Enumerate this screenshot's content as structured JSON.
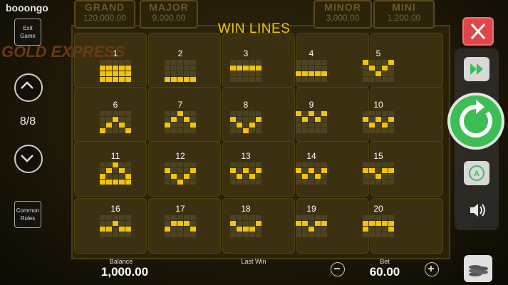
{
  "brand": "booongo",
  "jackpots": [
    {
      "name": "GRAND",
      "value": "120,000.00"
    },
    {
      "name": "MAJOR",
      "value": "9,000.00"
    },
    {
      "name": "MINOR",
      "value": "3,000.00"
    },
    {
      "name": "MINI",
      "value": "1,200.00"
    }
  ],
  "game_logo": "GOLD EXPRESS",
  "overlay": {
    "title": "WIN LINES",
    "lines": [
      {
        "number": "1",
        "pattern": [
          0,
          0,
          0,
          0,
          0,
          1,
          1,
          1,
          1,
          1,
          1,
          1,
          1,
          1,
          1,
          1,
          1,
          1,
          1,
          1
        ]
      },
      {
        "number": "2",
        "pattern": [
          0,
          0,
          0,
          0,
          0,
          0,
          0,
          0,
          0,
          0,
          0,
          0,
          0,
          0,
          0,
          1,
          1,
          1,
          1,
          1
        ]
      },
      {
        "number": "3",
        "pattern": [
          0,
          0,
          0,
          0,
          0,
          1,
          1,
          1,
          1,
          1,
          0,
          0,
          0,
          0,
          0,
          0,
          0,
          0,
          0,
          0
        ]
      },
      {
        "number": "4",
        "pattern": [
          0,
          0,
          0,
          0,
          0,
          0,
          0,
          0,
          0,
          0,
          1,
          1,
          1,
          1,
          1,
          0,
          0,
          0,
          0,
          0
        ]
      },
      {
        "number": "5",
        "pattern": [
          1,
          0,
          0,
          0,
          1,
          0,
          1,
          0,
          1,
          0,
          0,
          0,
          1,
          0,
          0,
          0,
          0,
          0,
          0,
          0
        ]
      },
      {
        "number": "6",
        "pattern": [
          0,
          0,
          0,
          0,
          0,
          0,
          0,
          1,
          0,
          0,
          0,
          1,
          0,
          1,
          0,
          1,
          0,
          0,
          0,
          1
        ]
      },
      {
        "number": "7",
        "pattern": [
          0,
          0,
          1,
          0,
          0,
          0,
          1,
          0,
          1,
          0,
          1,
          0,
          0,
          0,
          1,
          0,
          0,
          0,
          0,
          0
        ]
      },
      {
        "number": "8",
        "pattern": [
          0,
          0,
          0,
          0,
          0,
          1,
          0,
          0,
          0,
          1,
          0,
          1,
          0,
          1,
          0,
          0,
          0,
          1,
          0,
          0
        ]
      },
      {
        "number": "9",
        "pattern": [
          1,
          0,
          1,
          0,
          1,
          0,
          1,
          0,
          1,
          0,
          0,
          0,
          0,
          0,
          0,
          0,
          0,
          0,
          0,
          0
        ]
      },
      {
        "number": "10",
        "pattern": [
          0,
          0,
          0,
          0,
          0,
          1,
          0,
          1,
          0,
          1,
          0,
          1,
          0,
          1,
          0,
          0,
          0,
          0,
          0,
          0
        ]
      },
      {
        "number": "11",
        "pattern": [
          0,
          0,
          1,
          0,
          0,
          0,
          1,
          0,
          1,
          0,
          1,
          0,
          0,
          0,
          1,
          1,
          1,
          1,
          1,
          1
        ]
      },
      {
        "number": "12",
        "pattern": [
          0,
          0,
          0,
          0,
          0,
          1,
          0,
          0,
          0,
          1,
          0,
          1,
          0,
          1,
          0,
          0,
          0,
          1,
          0,
          0
        ]
      },
      {
        "number": "13",
        "pattern": [
          0,
          0,
          0,
          0,
          0,
          1,
          0,
          1,
          0,
          1,
          0,
          1,
          0,
          1,
          0,
          0,
          0,
          0,
          0,
          0
        ]
      },
      {
        "number": "14",
        "pattern": [
          0,
          0,
          0,
          0,
          0,
          1,
          0,
          1,
          0,
          1,
          0,
          1,
          0,
          1,
          0,
          0,
          0,
          0,
          0,
          0
        ]
      },
      {
        "number": "15",
        "pattern": [
          0,
          0,
          0,
          0,
          0,
          1,
          1,
          0,
          1,
          1,
          0,
          0,
          1,
          0,
          0,
          0,
          0,
          0,
          0,
          0
        ]
      },
      {
        "number": "16",
        "pattern": [
          0,
          0,
          0,
          0,
          0,
          0,
          0,
          1,
          0,
          0,
          1,
          1,
          0,
          1,
          1,
          0,
          0,
          0,
          0,
          0
        ]
      },
      {
        "number": "17",
        "pattern": [
          0,
          0,
          0,
          0,
          0,
          0,
          1,
          1,
          1,
          0,
          1,
          0,
          0,
          0,
          1,
          0,
          0,
          0,
          0,
          0
        ]
      },
      {
        "number": "18",
        "pattern": [
          0,
          0,
          0,
          0,
          0,
          1,
          0,
          0,
          0,
          1,
          0,
          1,
          1,
          1,
          0,
          0,
          0,
          0,
          0,
          0
        ]
      },
      {
        "number": "19",
        "pattern": [
          0,
          0,
          0,
          0,
          0,
          1,
          1,
          0,
          1,
          1,
          0,
          0,
          1,
          0,
          0,
          0,
          0,
          0,
          0,
          0
        ]
      },
      {
        "number": "20",
        "pattern": [
          0,
          0,
          0,
          0,
          0,
          1,
          1,
          1,
          1,
          1,
          1,
          0,
          0,
          0,
          1,
          0,
          0,
          0,
          0,
          0
        ]
      }
    ]
  },
  "left_panel": {
    "exit_label": "Exit Game",
    "page_indicator": "8/8",
    "rules_label": "Common Rules"
  },
  "bottom_bar": {
    "balance_label": "Balance",
    "balance_value": "1,000.00",
    "last_win_label": "Last Win",
    "last_win_value": "",
    "bet_label": "Bet",
    "bet_value": "60.00"
  },
  "colors": {
    "accent_yellow": "#f5c400",
    "close_red": "#e04848",
    "spin_green": "#3dbd56"
  },
  "icons": [
    "close-icon",
    "fast-forward-icon",
    "spin-icon",
    "autoplay-icon",
    "sound-icon",
    "coins-icon",
    "chevron-up-icon",
    "chevron-down-icon",
    "minus-icon",
    "plus-icon"
  ]
}
